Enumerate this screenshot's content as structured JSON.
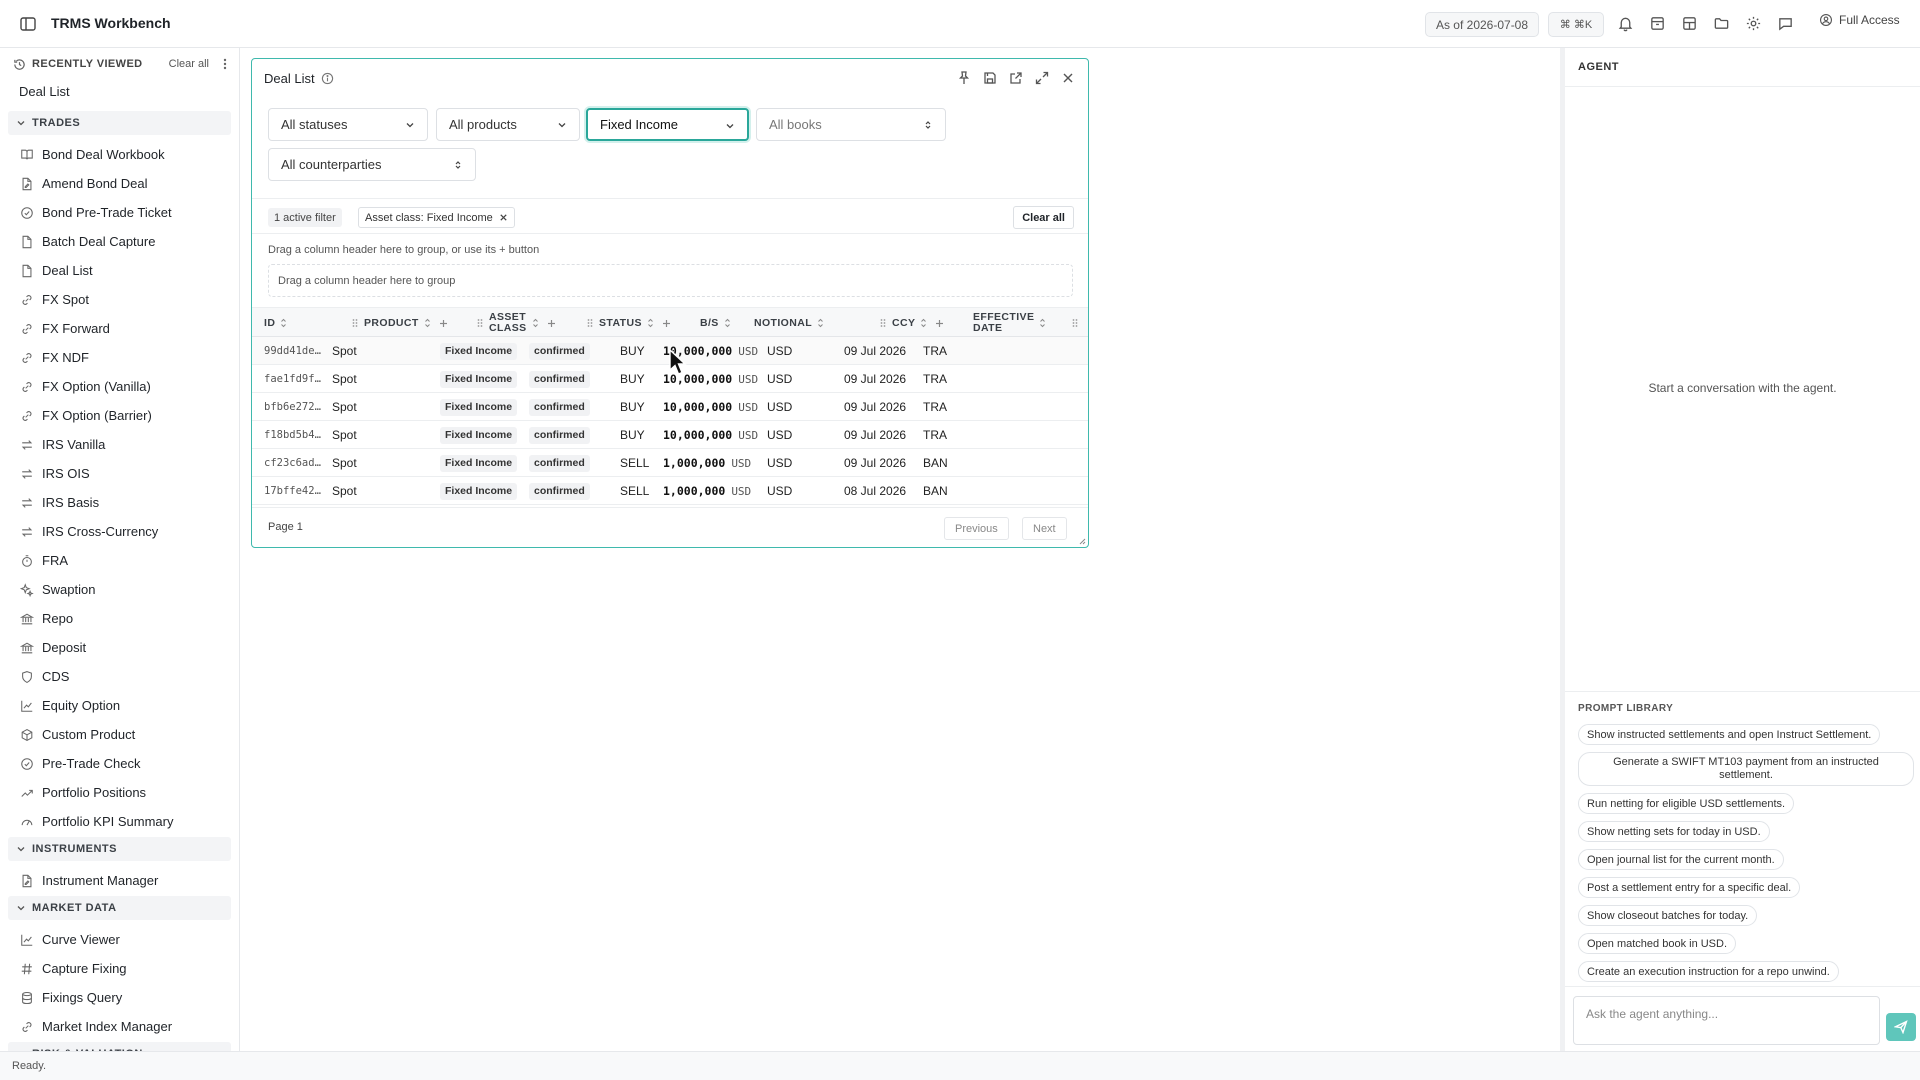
{
  "app": {
    "title": "TRMS Workbench"
  },
  "topbar": {
    "as_of": "As of 2026-07-08",
    "shortcut": "⌘ ⌘K",
    "access": "Full Access"
  },
  "sidebar": {
    "recent_title": "RECENTLY VIEWED",
    "clear_all": "Clear all",
    "recent_items": [
      "Deal List"
    ],
    "sections": [
      {
        "label": "TRADES",
        "items": [
          {
            "label": "Bond Deal Workbook",
            "icon": "book-icon"
          },
          {
            "label": "Amend Bond Deal",
            "icon": "file-edit-icon"
          },
          {
            "label": "Bond Pre-Trade Ticket",
            "icon": "check-circle-icon"
          },
          {
            "label": "Batch Deal Capture",
            "icon": "file-icon"
          },
          {
            "label": "Deal List",
            "icon": "file-icon"
          },
          {
            "label": "FX Spot",
            "icon": "link-icon"
          },
          {
            "label": "FX Forward",
            "icon": "link-icon"
          },
          {
            "label": "FX NDF",
            "icon": "link-icon"
          },
          {
            "label": "FX Option (Vanilla)",
            "icon": "link-icon"
          },
          {
            "label": "FX Option (Barrier)",
            "icon": "link-icon"
          },
          {
            "label": "IRS Vanilla",
            "icon": "swap-icon"
          },
          {
            "label": "IRS OIS",
            "icon": "swap-icon"
          },
          {
            "label": "IRS Basis",
            "icon": "swap-icon"
          },
          {
            "label": "IRS Cross-Currency",
            "icon": "swap-icon"
          },
          {
            "label": "FRA",
            "icon": "timer-icon"
          },
          {
            "label": "Swaption",
            "icon": "sparkle-icon"
          },
          {
            "label": "Repo",
            "icon": "bank-icon"
          },
          {
            "label": "Deposit",
            "icon": "bank-icon"
          },
          {
            "label": "CDS",
            "icon": "shield-icon"
          },
          {
            "label": "Equity Option",
            "icon": "chart-line-icon"
          },
          {
            "label": "Custom Product",
            "icon": "box-icon"
          },
          {
            "label": "Pre-Trade Check",
            "icon": "check-circle-icon"
          },
          {
            "label": "Portfolio Positions",
            "icon": "trend-up-icon"
          },
          {
            "label": "Portfolio KPI Summary",
            "icon": "gauge-icon"
          }
        ]
      },
      {
        "label": "INSTRUMENTS",
        "items": [
          {
            "label": "Instrument Manager",
            "icon": "file-edit-icon"
          }
        ]
      },
      {
        "label": "MARKET DATA",
        "items": [
          {
            "label": "Curve Viewer",
            "icon": "chart-line-icon"
          },
          {
            "label": "Capture Fixing",
            "icon": "hash-icon"
          },
          {
            "label": "Fixings Query",
            "icon": "database-icon"
          },
          {
            "label": "Market Index Manager",
            "icon": "link-icon"
          }
        ]
      },
      {
        "label": "RISK & VALUATION",
        "items": []
      }
    ]
  },
  "panel": {
    "title": "Deal List",
    "filters": {
      "status": "All statuses",
      "product": "All products",
      "asset_class": "Fixed Income",
      "books": "All books",
      "counterparties": "All counterparties"
    },
    "active_filter_count": "1 active filter",
    "active_chip": "Asset class: Fixed Income",
    "clear_all": "Clear all",
    "group_hint": "Drag a column header here to group, or use its + button",
    "group_drop": "Drag a column header here to group",
    "columns": {
      "id": "ID",
      "product": "PRODUCT",
      "asset_class": [
        "ASSET",
        "CLASS"
      ],
      "status": "STATUS",
      "bs": "B/S",
      "notional": "NOTIONAL",
      "ccy": "CCY",
      "effective_date": [
        "EFFECTIVE",
        "DATE"
      ]
    },
    "rows": [
      {
        "id": "99dd41de…",
        "product": "Spot",
        "asset_class": "Fixed Income",
        "status": "confirmed",
        "bs": "BUY",
        "notional": "10,000,000",
        "notional_ccy": "USD",
        "ccy": "USD",
        "effective_date": "09 Jul 2026",
        "cpty": "TRA"
      },
      {
        "id": "fae1fd9f…",
        "product": "Spot",
        "asset_class": "Fixed Income",
        "status": "confirmed",
        "bs": "BUY",
        "notional": "10,000,000",
        "notional_ccy": "USD",
        "ccy": "USD",
        "effective_date": "09 Jul 2026",
        "cpty": "TRA"
      },
      {
        "id": "bfb6e272…",
        "product": "Spot",
        "asset_class": "Fixed Income",
        "status": "confirmed",
        "bs": "BUY",
        "notional": "10,000,000",
        "notional_ccy": "USD",
        "ccy": "USD",
        "effective_date": "09 Jul 2026",
        "cpty": "TRA"
      },
      {
        "id": "f18bd5b4…",
        "product": "Spot",
        "asset_class": "Fixed Income",
        "status": "confirmed",
        "bs": "BUY",
        "notional": "10,000,000",
        "notional_ccy": "USD",
        "ccy": "USD",
        "effective_date": "09 Jul 2026",
        "cpty": "TRA"
      },
      {
        "id": "cf23c6ad…",
        "product": "Spot",
        "asset_class": "Fixed Income",
        "status": "confirmed",
        "bs": "SELL",
        "notional": "1,000,000",
        "notional_ccy": "USD",
        "ccy": "USD",
        "effective_date": "09 Jul 2026",
        "cpty": "BAN"
      },
      {
        "id": "17bffe42…",
        "product": "Spot",
        "asset_class": "Fixed Income",
        "status": "confirmed",
        "bs": "SELL",
        "notional": "1,000,000",
        "notional_ccy": "USD",
        "ccy": "USD",
        "effective_date": "08 Jul 2026",
        "cpty": "BAN"
      }
    ],
    "page": "Page 1",
    "previous": "Previous",
    "next": "Next"
  },
  "agent": {
    "title": "AGENT",
    "empty": "Start a conversation with the agent.",
    "prompt_library_title": "PROMPT LIBRARY",
    "prompts": [
      "Show instructed settlements and open Instruct Settlement.",
      "Generate a SWIFT MT103 payment from an instructed settlement.",
      "Run netting for eligible USD settlements.",
      "Show netting sets for today in USD.",
      "Open journal list for the current month.",
      "Post a settlement entry for a specific deal.",
      "Show closeout batches for today.",
      "Open matched book in USD.",
      "Create an execution instruction for a repo unwind."
    ],
    "input_placeholder": "Ask the agent anything..."
  },
  "status": {
    "text": "Ready."
  },
  "colors": {
    "accent": "#3fb9ad",
    "send": "#5fc6bb"
  }
}
